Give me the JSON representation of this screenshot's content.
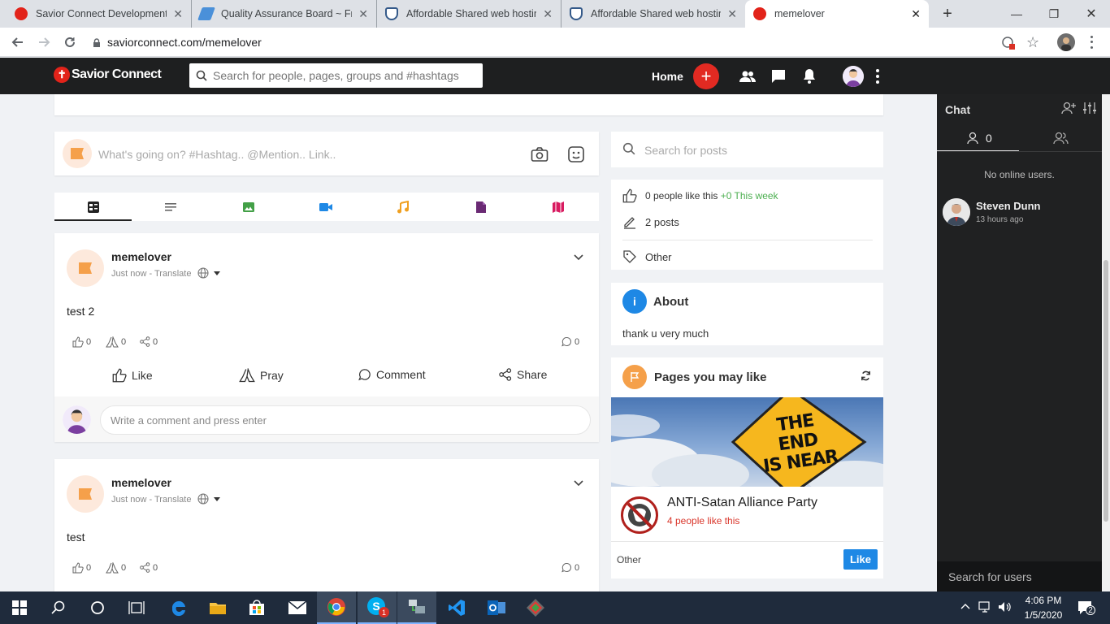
{
  "browser": {
    "tabs": [
      {
        "title": "Savior Connect Development"
      },
      {
        "title": "Quality Assurance Board ~ Fro"
      },
      {
        "title": "Affordable Shared web hosting"
      },
      {
        "title": "Affordable Shared web hosting"
      },
      {
        "title": "memelover"
      }
    ],
    "url": "saviorconnect.com/memelover"
  },
  "header": {
    "logo": "Savior Connect",
    "search_placeholder": "Search for people, pages, groups and #hashtags",
    "home_label": "Home"
  },
  "composer": {
    "placeholder": "What's going on? #Hashtag.. @Mention.. Link.."
  },
  "posts": [
    {
      "author": "memelover",
      "meta": "Just now - Translate",
      "text": "test 2",
      "likes": "0",
      "prays": "0",
      "shares": "0",
      "comments": "0"
    },
    {
      "author": "memelover",
      "meta": "Just now - Translate",
      "text": "test",
      "likes": "0",
      "prays": "0",
      "shares": "0",
      "comments": "0"
    }
  ],
  "post_actions": {
    "like": "Like",
    "pray": "Pray",
    "comment": "Comment",
    "share": "Share"
  },
  "comment_placeholder": "Write a comment and press enter",
  "sidebar": {
    "search_placeholder": "Search for posts",
    "likes_text": "0 people like this",
    "likes_week": "+0 This week",
    "posts_text": "2 posts",
    "category": "Other",
    "about_title": "About",
    "about_text": "thank u very much",
    "pages_title": "Pages you may like",
    "page_sign_line1": "THE END",
    "page_sign_line2": "IS NEAR",
    "page_name": "ANTI-Satan Alliance Party",
    "page_likes": "4 people like this",
    "page_category": "Other",
    "like_button": "Like"
  },
  "chat": {
    "title": "Chat",
    "online_count": "0",
    "no_online": "No online users.",
    "user_name": "Steven Dunn",
    "user_time": "13 hours ago",
    "search_placeholder": "Search for users"
  },
  "taskbar": {
    "time": "4:06 PM",
    "date": "1/5/2020",
    "notifications": "2",
    "skype_badge": "1"
  },
  "colors": {
    "brand_red": "#e22a22",
    "header_bg": "#1e1f20",
    "link_blue": "#1e88e5",
    "green": "#4caf50"
  }
}
